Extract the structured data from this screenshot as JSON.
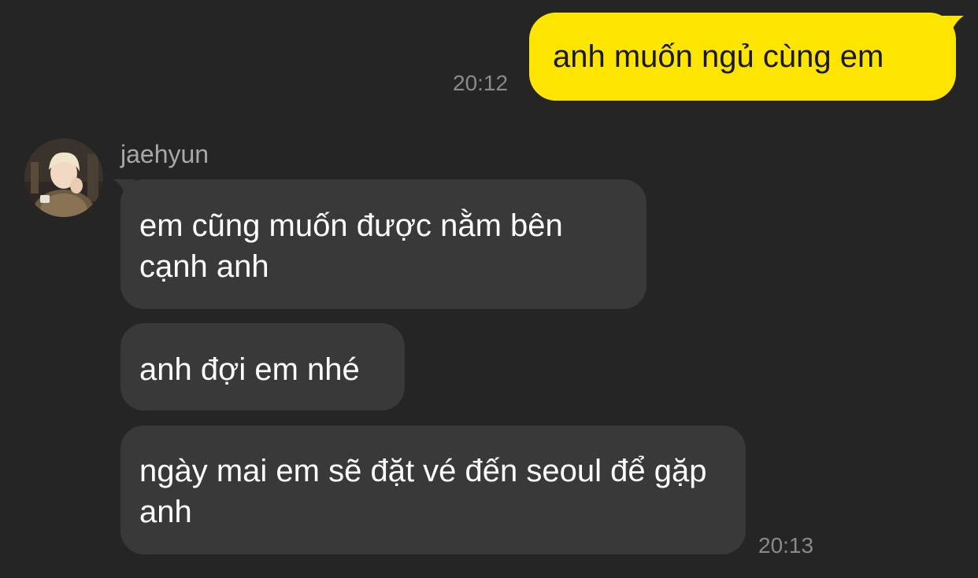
{
  "conversation": {
    "contact_name": "jaehyun",
    "colors": {
      "background": "#252525",
      "outgoing_bubble": "#fee500",
      "incoming_bubble": "#393939",
      "timestamp": "#8a8a8a"
    },
    "outgoing": [
      {
        "text": "anh muốn ngủ cùng em",
        "time": "20:12"
      }
    ],
    "incoming": [
      {
        "text": "em cũng muốn được nằm bên cạnh anh"
      },
      {
        "text": "anh đợi em nhé"
      },
      {
        "text": "ngày mai em sẽ đặt vé đến seoul để gặp anh",
        "time": "20:13"
      }
    ]
  }
}
